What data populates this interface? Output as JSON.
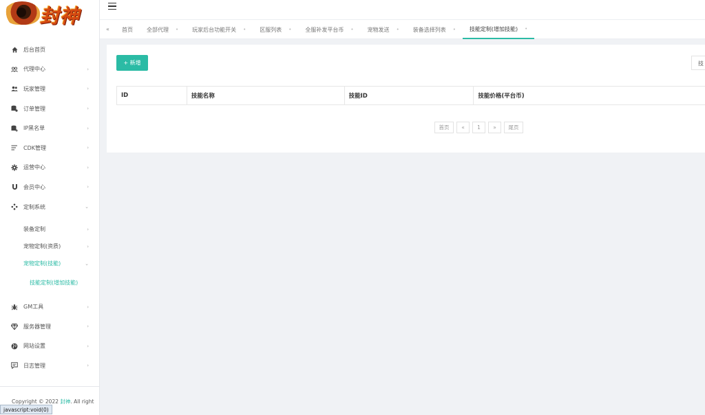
{
  "logo": {
    "text": "封神"
  },
  "sidebar": {
    "items": [
      {
        "label": "后台首页",
        "icon": "home-icon",
        "arrow": ""
      },
      {
        "label": "代理中心",
        "icon": "agent-icon",
        "arrow": "›"
      },
      {
        "label": "玩家管理",
        "icon": "users-icon",
        "arrow": "›"
      },
      {
        "label": "订单管理",
        "icon": "order-icon",
        "arrow": "›"
      },
      {
        "label": "IP黑名单",
        "icon": "blacklist-icon",
        "arrow": "›"
      },
      {
        "label": "CDK管理",
        "icon": "list-icon",
        "arrow": "›"
      },
      {
        "label": "运营中心",
        "icon": "gear-icon",
        "arrow": "›"
      },
      {
        "label": "会员中心",
        "icon": "magnet-icon",
        "arrow": "›"
      },
      {
        "label": "定制系统",
        "icon": "gamepad-icon",
        "arrow": "⌄"
      }
    ],
    "sub_items": [
      {
        "label": "装备定制",
        "arrow": "›"
      },
      {
        "label": "宠物定制(资质)",
        "arrow": "›"
      },
      {
        "label": "宠物定制(技能)",
        "arrow": "⌄"
      }
    ],
    "sub2_item": {
      "label": "技能定制(增加技能)"
    },
    "bottom_items": [
      {
        "label": "GM工具",
        "icon": "bug-icon",
        "arrow": "›"
      },
      {
        "label": "服务器管理",
        "icon": "diamond-icon",
        "arrow": "›"
      },
      {
        "label": "网站设置",
        "icon": "globe-icon",
        "arrow": "›"
      },
      {
        "label": "日志管理",
        "icon": "comment-icon",
        "arrow": "›"
      }
    ]
  },
  "footer": {
    "copyright_prefix": "Copyright © 2022 ",
    "brand": "封神",
    "copyright_suffix": ". All right"
  },
  "status_bar": {
    "url": "javascript:void(0)"
  },
  "tabs": {
    "nav_icon": "«",
    "items": [
      {
        "label": "首页"
      },
      {
        "label": "全部代理"
      },
      {
        "label": "玩家后台功能开关"
      },
      {
        "label": "区服列表"
      },
      {
        "label": "全服补发平台币"
      },
      {
        "label": "宠物发送"
      },
      {
        "label": "装备选择列表"
      },
      {
        "label": "技能定制(增加技能)"
      }
    ],
    "close_glyph": "•"
  },
  "content": {
    "add_button": "+ 新增",
    "search_placeholder": "技",
    "table": {
      "columns": [
        "ID",
        "技能名称",
        "技能ID",
        "技能价格(平台币)"
      ]
    },
    "pager": {
      "first": "首页",
      "prev": "«",
      "current": "1",
      "next": "»",
      "last": "尾页"
    }
  },
  "colors": {
    "accent": "#2bbba5"
  }
}
